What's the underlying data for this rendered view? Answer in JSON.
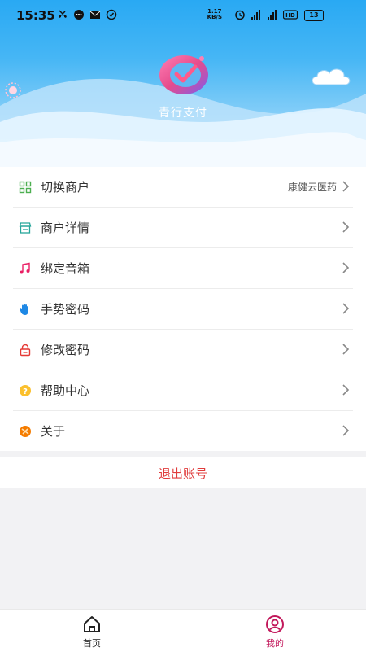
{
  "status_bar": {
    "time": "15:35",
    "speed_value": "1.17",
    "speed_unit": "KB/S",
    "battery": "13",
    "icons": [
      "missed-call-icon",
      "message-icon",
      "mail-icon",
      "check-circle-icon",
      "alarm-icon",
      "signal-icon",
      "signal-icon",
      "hd-icon"
    ]
  },
  "header": {
    "app_name": "青行支付",
    "logo": "brand-logo"
  },
  "menu": {
    "items": [
      {
        "label": "切换商户",
        "value": "康健云医药",
        "icon": "grid-icon",
        "color": "#4caf50"
      },
      {
        "label": "商户详情",
        "value": "",
        "icon": "store-icon",
        "color": "#26a69a"
      },
      {
        "label": "绑定音箱",
        "value": "",
        "icon": "music-note-icon",
        "color": "#e91e63"
      },
      {
        "label": "手势密码",
        "value": "",
        "icon": "hand-icon",
        "color": "#1e88e5"
      },
      {
        "label": "修改密码",
        "value": "",
        "icon": "lock-icon",
        "color": "#e53935"
      },
      {
        "label": "帮助中心",
        "value": "",
        "icon": "help-icon",
        "color": "#fbc02d"
      },
      {
        "label": "关于",
        "value": "",
        "icon": "info-icon",
        "color": "#f57c00"
      }
    ]
  },
  "logout": {
    "label": "退出账号",
    "color": "#e03c3c"
  },
  "tabbar": {
    "home": {
      "label": "首页",
      "icon": "home-icon",
      "color": "#222222"
    },
    "mine": {
      "label": "我的",
      "icon": "user-circle-icon",
      "color": "#c2185b"
    }
  }
}
